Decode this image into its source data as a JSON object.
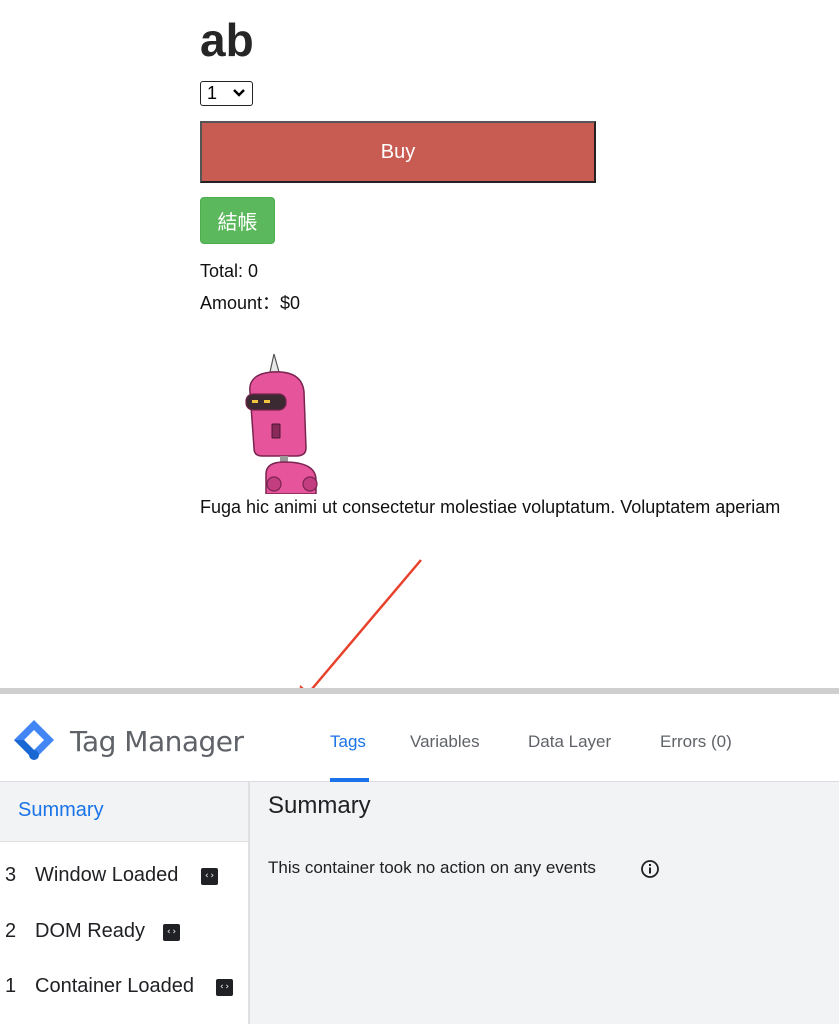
{
  "page": {
    "product_title": "ab",
    "quantity_selected": "1",
    "buy_label": "Buy",
    "checkout_label": "結帳",
    "total_text": "Total: 0",
    "amount_text": "Amount：$0",
    "lorem_text": "Fuga hic animi ut consectetur molestiae voluptatum. Voluptatem aperiam"
  },
  "gtm": {
    "title": "Tag Manager",
    "tabs": [
      {
        "label": "Tags",
        "active": true
      },
      {
        "label": "Variables",
        "active": false
      },
      {
        "label": "Data Layer",
        "active": false
      },
      {
        "label": "Errors (0)",
        "active": false
      }
    ],
    "sidebar": {
      "summary_label": "Summary",
      "events": [
        {
          "num": "3",
          "name": "Window Loaded",
          "icon": "code-icon"
        },
        {
          "num": "2",
          "name": "DOM Ready",
          "icon": "code-icon"
        },
        {
          "num": "1",
          "name": "Container Loaded",
          "icon": "code-icon"
        }
      ]
    },
    "main": {
      "title": "Summary",
      "message": "This container took no action on any events"
    }
  },
  "colors": {
    "buy_button": "#c85b52",
    "checkout_button": "#5cb85c",
    "gtm_accent": "#1a73e8",
    "annotation_arrow": "#e8412c"
  }
}
